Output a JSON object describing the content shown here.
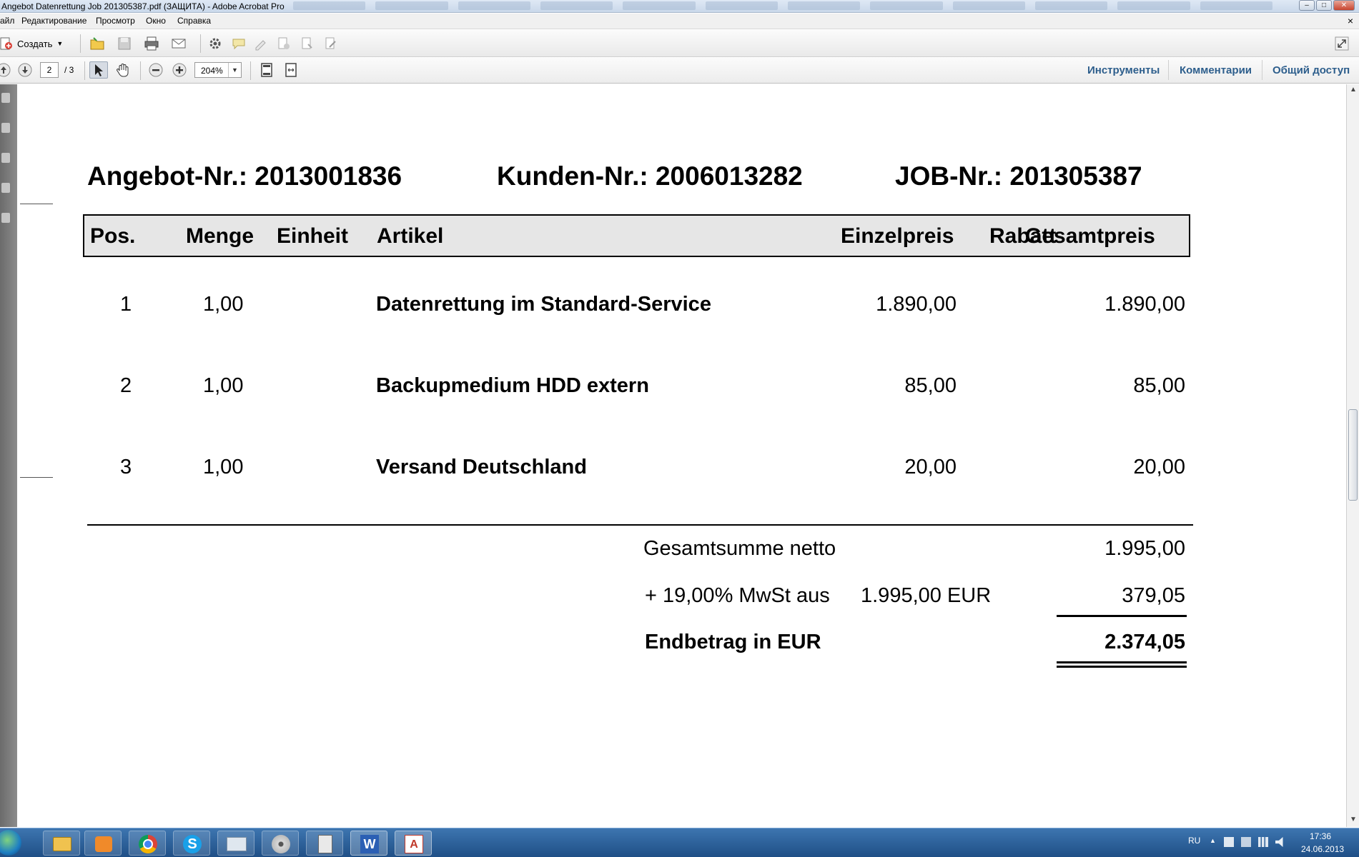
{
  "window": {
    "title": "Angebot Datenrettung Job 201305387.pdf (ЗАЩИТА) - Adobe Acrobat Pro",
    "controls": {
      "minimize": "–",
      "maximize": "□",
      "close": "✕"
    }
  },
  "menubar": {
    "items": [
      "айл",
      "Редактирование",
      "Просмотр",
      "Окно",
      "Справка"
    ],
    "close_doc": "×"
  },
  "toolbar1": {
    "create_label": "Создать",
    "icons": [
      "create-icon",
      "open-folder-icon",
      "save-icon",
      "print-icon",
      "email-icon",
      "gear-icon",
      "comment-icon",
      "highlight-icon",
      "stamp-icon",
      "attach-icon",
      "sign-icon",
      "expand-icon"
    ]
  },
  "toolbar2": {
    "current_page": "2",
    "total_pages": "/ 3",
    "zoom": "204%",
    "panel_links": [
      "Инструменты",
      "Комментарии",
      "Общий доступ"
    ]
  },
  "document": {
    "header": {
      "angebot": "Angebot-Nr.: 2013001836",
      "kunden": "Kunden-Nr.: 2006013282",
      "job": "JOB-Nr.: 201305387"
    },
    "columns": {
      "pos": "Pos.",
      "menge": "Menge",
      "einheit": "Einheit",
      "artikel": "Artikel",
      "einzelpreis": "Einzelpreis",
      "rabatt": "Rabatt",
      "gesamtpreis": "Gesamtpreis"
    },
    "rows": [
      {
        "pos": "1",
        "menge": "1,00",
        "artikel": "Datenrettung im Standard-Service",
        "einzelpreis": "1.890,00",
        "gesamtpreis": "1.890,00"
      },
      {
        "pos": "2",
        "menge": "1,00",
        "artikel": "Backupmedium HDD extern",
        "einzelpreis": "85,00",
        "gesamtpreis": "85,00"
      },
      {
        "pos": "3",
        "menge": "1,00",
        "artikel": "Versand Deutschland",
        "einzelpreis": "20,00",
        "gesamtpreis": "20,00"
      }
    ],
    "totals": {
      "netto_label": "Gesamtsumme netto",
      "netto_value": "1.995,00",
      "mwst_label": "+ 19,00% MwSt aus",
      "mwst_base": "1.995,00 EUR",
      "mwst_value": "379,05",
      "end_label": "Endbetrag in EUR",
      "end_value": "2.374,05"
    }
  },
  "taskbar": {
    "apps": [
      "explorer-icon",
      "media-player-icon",
      "chrome-icon",
      "skype-icon",
      "control-panel-icon",
      "disc-icon",
      "calculator-icon",
      "word-icon",
      "acrobat-icon"
    ],
    "language": "RU",
    "time": "17:36",
    "date": "24.06.2013"
  }
}
